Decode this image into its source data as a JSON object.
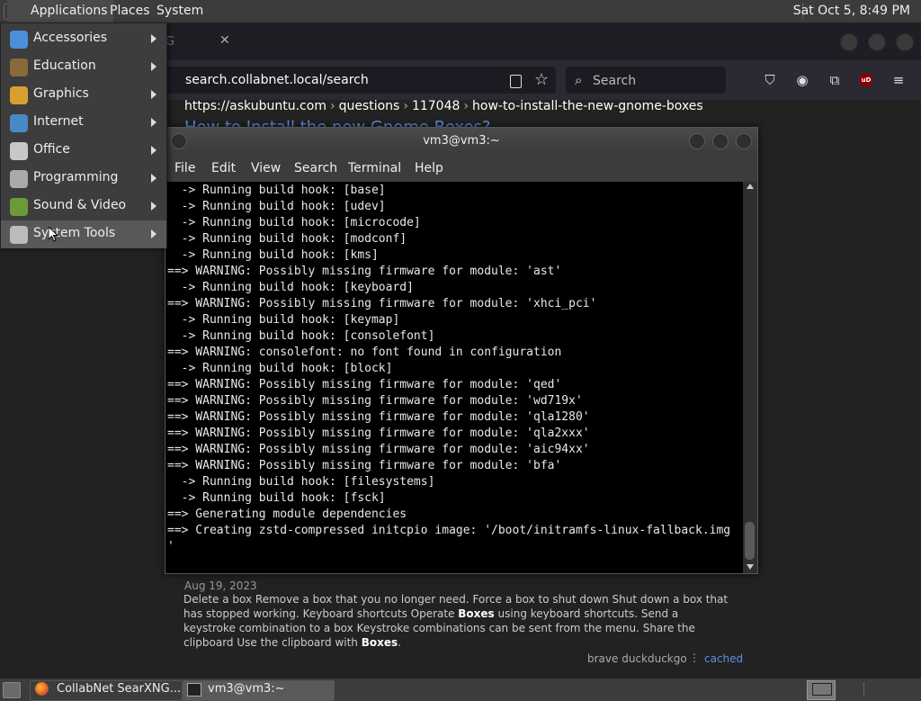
{
  "top_panel": {
    "menus": [
      "Applications",
      "Places",
      "System"
    ],
    "clock": "Sat Oct  5,  8:49 PM"
  },
  "browser": {
    "tab_title_fragment": "G",
    "url": "search.collabnet.local/search",
    "search_placeholder": "Search",
    "ublock_badge": "uD",
    "result": {
      "breadcrumb": [
        "https://askubuntu.com",
        "questions",
        "117048",
        "how-to-install-the-new-gnome-boxes"
      ],
      "title": "How to Install the new Gnome Boxes?",
      "date": "Aug 19, 2023",
      "snippet_1": "Delete a box Remove a box that you no longer need. Force a box to shut down Shut down a box that has stopped working. Keyboard shortcuts Operate ",
      "snippet_b1": "Boxes",
      "snippet_2": " using keyboard shortcuts. Send a keystroke combination to a box Keystroke combinations can be sent from the menu. Share the clipboard Use the clipboard with ",
      "snippet_b2": "Boxes",
      "snippet_3": ".",
      "engines": "brave   duckduckgo",
      "engine_dots": "⋮",
      "cached": "cached"
    }
  },
  "apps_menu": {
    "items": [
      {
        "label": "Accessories",
        "icon": "accessories-icon",
        "color": "#4a8fd8"
      },
      {
        "label": "Education",
        "icon": "education-icon",
        "color": "#8a6a3a"
      },
      {
        "label": "Graphics",
        "icon": "graphics-icon",
        "color": "#d8a030"
      },
      {
        "label": "Internet",
        "icon": "internet-icon",
        "color": "#4a88c8"
      },
      {
        "label": "Office",
        "icon": "office-icon",
        "color": "#c8c8c8"
      },
      {
        "label": "Programming",
        "icon": "programming-icon",
        "color": "#aaaaaa"
      },
      {
        "label": "Sound & Video",
        "icon": "sound-video-icon",
        "color": "#6a9a3a"
      },
      {
        "label": "System Tools",
        "icon": "system-tools-icon",
        "color": "#bbbbbb"
      }
    ],
    "active_index": 7
  },
  "terminal": {
    "title": "vm3@vm3:~",
    "menus": [
      "File",
      "Edit",
      "View",
      "Search",
      "Terminal",
      "Help"
    ],
    "lines": [
      "  -> Running build hook: [base]",
      "  -> Running build hook: [udev]",
      "  -> Running build hook: [microcode]",
      "  -> Running build hook: [modconf]",
      "  -> Running build hook: [kms]",
      "==> WARNING: Possibly missing firmware for module: 'ast'",
      "  -> Running build hook: [keyboard]",
      "==> WARNING: Possibly missing firmware for module: 'xhci_pci'",
      "  -> Running build hook: [keymap]",
      "  -> Running build hook: [consolefont]",
      "==> WARNING: consolefont: no font found in configuration",
      "  -> Running build hook: [block]",
      "==> WARNING: Possibly missing firmware for module: 'qed'",
      "==> WARNING: Possibly missing firmware for module: 'wd719x'",
      "==> WARNING: Possibly missing firmware for module: 'qla1280'",
      "==> WARNING: Possibly missing firmware for module: 'qla2xxx'",
      "==> WARNING: Possibly missing firmware for module: 'aic94xx'",
      "==> WARNING: Possibly missing firmware for module: 'bfa'",
      "  -> Running build hook: [filesystems]",
      "  -> Running build hook: [fsck]",
      "==> Generating module dependencies",
      "==> Creating zstd-compressed initcpio image: '/boot/initramfs-linux-fallback.img",
      "'"
    ]
  },
  "taskbar": {
    "tasks": [
      "CollabNet SearXNG...",
      "vm3@vm3:~"
    ]
  }
}
